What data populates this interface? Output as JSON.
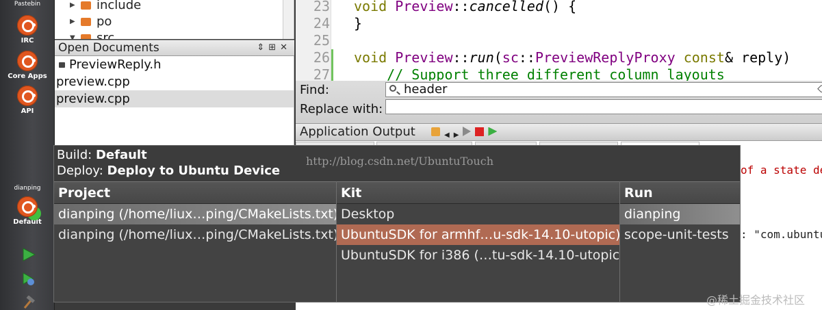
{
  "modes": [
    {
      "name": "pastebin",
      "label": "Pastebin"
    },
    {
      "name": "irc",
      "label": "IRC"
    },
    {
      "name": "core-apps",
      "label": "Core Apps"
    },
    {
      "name": "api",
      "label": "API"
    }
  ],
  "target": {
    "project": "dianping",
    "config": "Default"
  },
  "tree": [
    "include",
    "po",
    "src"
  ],
  "open_docs": {
    "title": "Open Documents",
    "items": [
      "PreviewReply.h",
      "preview.cpp",
      "preview.cpp"
    ]
  },
  "editor": {
    "lines": [
      {
        "num": "23",
        "code": "void Preview::cancelled() {"
      },
      {
        "num": "24",
        "code": "}"
      },
      {
        "num": "25",
        "code": ""
      },
      {
        "num": "26",
        "code": "void Preview::run(sc::PreviewReplyProxy const& reply)"
      },
      {
        "num": "27",
        "code": "    // Support three different column layouts"
      }
    ]
  },
  "find": {
    "find_label": "Find:",
    "find_value": "header",
    "replace_label": "Replace with:",
    "replace_value": ""
  },
  "output": {
    "title": "Application Output",
    "text1": "of a state de",
    "text2": ": \"com.ubuntu"
  },
  "popup": {
    "build_label": "Build:",
    "build_value": "Default",
    "deploy_label": "Deploy:",
    "deploy_value": "Deploy to Ubuntu Device",
    "columns": {
      "project": {
        "header": "Project",
        "items": [
          "dianping (/home/liux…ping/CMakeLists.txt)",
          "dianping (/home/liux…ping/CMakeLists.txt)"
        ]
      },
      "kit": {
        "header": "Kit",
        "items": [
          "Desktop",
          "UbuntuSDK for armhf…u-sdk-14.10-utopic)",
          "UbuntuSDK for i386 (…tu-sdk-14.10-utopic)"
        ]
      },
      "run": {
        "header": "Run",
        "items": [
          "dianping",
          "scope-unit-tests"
        ]
      }
    }
  },
  "watermark": "http://blog.csdn.net/UbuntuTouch",
  "corner_mark": "@稀土掘金技术社区",
  "colors": {
    "ubuntu_orange": "#e0561f",
    "keyword": "#7a7a00",
    "class": "#800080",
    "comment": "#008000",
    "kit_highlight": "#b06a53"
  }
}
